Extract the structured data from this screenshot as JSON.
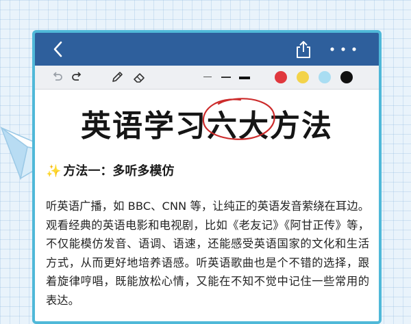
{
  "toolbar": {
    "icons": [
      "undo-icon",
      "redo-icon",
      "pen-icon",
      "eraser-icon"
    ],
    "line_widths": [
      "thin",
      "medium",
      "thick"
    ],
    "colors": [
      "#e0383e",
      "#f3d34a",
      "#a9ddf2",
      "#111111"
    ]
  },
  "topbar": {
    "icons": [
      "back-chevron-icon",
      "share-icon",
      "more-icon"
    ],
    "color": "#2e5f9c"
  },
  "document": {
    "title": "英语学习六大方法",
    "method_prefix": "✨",
    "method_label": "方法一：",
    "method_name": "多听多模仿",
    "paragraph": "听英语广播，如 BBC、CNN 等，让纯正的英语发音萦绕在耳边。观看经典的英语电影和电视剧，比如《老友记》《阿甘正传》等，不仅能模仿发音、语调、语速，还能感受英语国家的文化和生活方式，从而更好地培养语感。听英语歌曲也是个不错的选择，跟着旋律哼唱，既能放松心情，又能在不知不觉中记住一些常用的表达。"
  },
  "accents": {
    "frame_border": "#4fb8d8",
    "circle_annotation": "#cc2b2b",
    "highlight": "#e9b4ec"
  }
}
